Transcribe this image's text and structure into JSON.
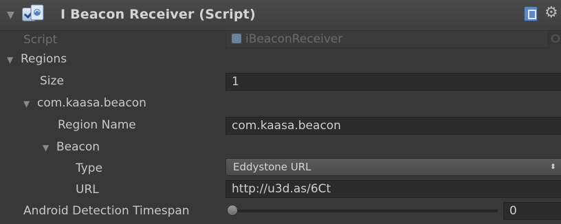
{
  "component": {
    "title": "I Beacon Receiver (Script)",
    "enabled": true
  },
  "fields": {
    "script_label": "Script",
    "script_value": "iBeaconReceiver",
    "regions_label": "Regions",
    "size_label": "Size",
    "size_value": "1",
    "region_item_label": "com.kaasa.beacon",
    "region_name_label": "Region Name",
    "region_name_value": "com.kaasa.beacon",
    "beacon_label": "Beacon",
    "type_label": "Type",
    "type_value": "Eddystone URL",
    "url_label": "URL",
    "url_value": "http://u3d.as/6Ct",
    "android_label": "Android Detection Timespan",
    "android_value": "0"
  },
  "icons": {
    "foldout": "triangle-down-icon",
    "script": "script-icon",
    "help": "book-icon",
    "settings": "gear-icon",
    "dropdown": "chevron-updown-icon"
  },
  "colors": {
    "background": "#383838",
    "field": "#2b2b2b",
    "text": "#c9c9c9"
  }
}
